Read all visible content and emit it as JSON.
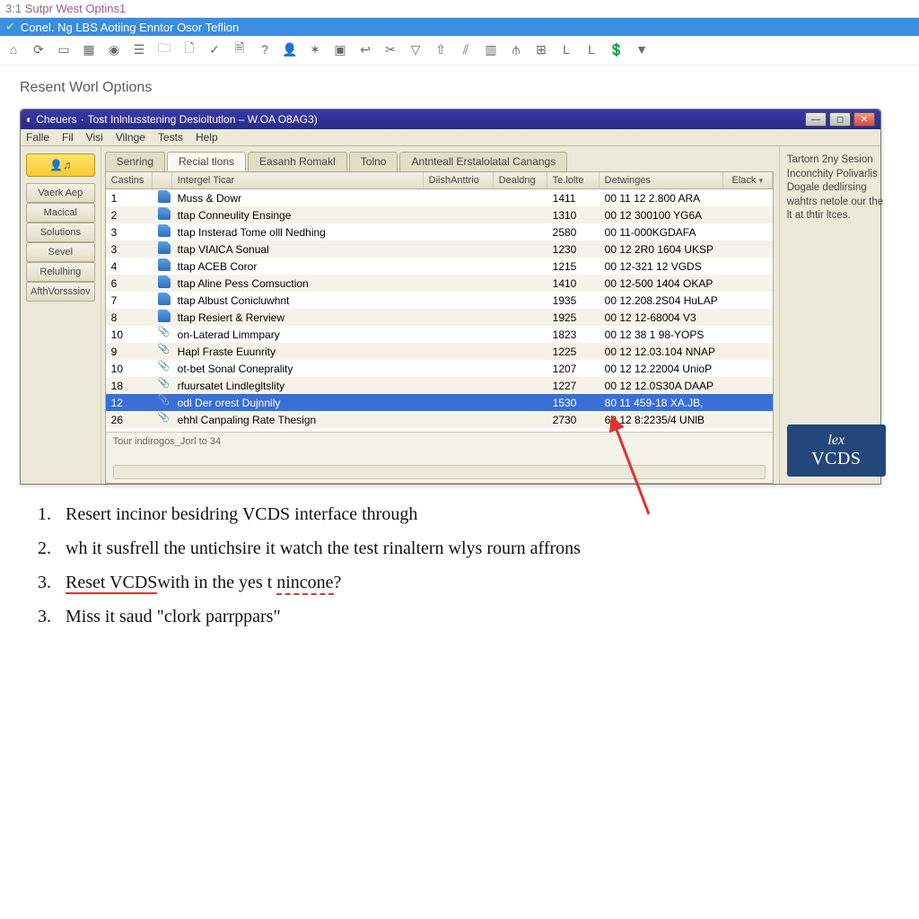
{
  "topbar1": {
    "prefix": "3:1",
    "title": "Sutpr West Optins1"
  },
  "topbar2": {
    "text": "Conel. Ng  LBS  Aotiing  Enntor  Osor  Teflion"
  },
  "toolbar_icons": [
    "home",
    "refresh",
    "window",
    "grid",
    "target",
    "form",
    "folder",
    "doc",
    "check",
    "page",
    "question",
    "user",
    "globe",
    "picture",
    "back",
    "scissors",
    "pin",
    "up",
    "chart",
    "grid2",
    "antenna",
    "table",
    "L1",
    "L2",
    "money",
    "filter"
  ],
  "page_title": "Resent Worl Options",
  "window": {
    "title": "Tost Inlnlusstening Desioltutlon – W.OA O8AG3)",
    "title_prefix": "Cheuers",
    "menus": [
      "Falle",
      "Fil",
      "Visi",
      "Vilnge",
      "Tests",
      "Help"
    ],
    "sidebar": {
      "buttons": [
        "Vaerk Aep",
        "Macical",
        "Solutions",
        "Sevel",
        "Relulhing",
        "AfthVorsssiov"
      ]
    },
    "tabs": [
      "Senring",
      "Recial tlons",
      "Easanh Romakl",
      "Tolno",
      "Antnteall Erstalolatal Canangs"
    ],
    "active_tab": 1,
    "columns": [
      "Castins",
      "Intergel Ticar",
      "DiishAnttrio",
      "Dealdng",
      "Te.lolte",
      "Detwinges",
      "Elack"
    ],
    "rows": [
      {
        "n": "1",
        "ic": "doc",
        "t": "Muss & Dowr",
        "d": "",
        "de": "",
        "te": "1411",
        "det": "00 11 12 2.800 ARA"
      },
      {
        "n": "2",
        "ic": "doc",
        "t": "ttap Conneulity Ensinge",
        "d": "",
        "de": "",
        "te": "1310",
        "det": "00 12 300100 YG6A"
      },
      {
        "n": "3",
        "ic": "doc",
        "t": "ttap Insterad Tome olll Nedhing",
        "d": "",
        "de": "",
        "te": "2580",
        "det": "00 11-000KGDAFA"
      },
      {
        "n": "3",
        "ic": "doc",
        "t": "ttap VIAlCA Sonual",
        "d": "",
        "de": "",
        "te": "1230",
        "det": "00 12 2R0 1604 UKSP"
      },
      {
        "n": "4",
        "ic": "doc",
        "t": "ttap ACEB Coror",
        "d": "",
        "de": "",
        "te": "1215",
        "det": "00 12-321 12 VGDS"
      },
      {
        "n": "6",
        "ic": "doc",
        "t": "ttap Aline Pess Comsuction",
        "d": "",
        "de": "",
        "te": "1410",
        "det": "00 12-500 1404 OKAP"
      },
      {
        "n": "7",
        "ic": "doc",
        "t": "ttap Albust Conicluwhnt",
        "d": "",
        "de": "",
        "te": "1935",
        "det": "00 12.208.2S04 HuLAP"
      },
      {
        "n": "8",
        "ic": "doc",
        "t": "ttap Resiert & Rerview",
        "d": "",
        "de": "",
        "te": "1925",
        "det": "00 12 12-68004 V3"
      },
      {
        "n": "10",
        "ic": "clip",
        "t": "on-Laterad Limmpary",
        "d": "",
        "de": "",
        "te": "1823",
        "det": "00 12 38 1 98-YOPS"
      },
      {
        "n": "9",
        "ic": "clip",
        "t": "Hapl Fraste Euunrity",
        "d": "",
        "de": "",
        "te": "1225",
        "det": "00 12 12.03.104 NNAP"
      },
      {
        "n": "10",
        "ic": "clip",
        "t": "ot-bet Sonal Coneprality",
        "d": "",
        "de": "",
        "te": "1207",
        "det": "00 12 12.22004 UnioP"
      },
      {
        "n": "18",
        "ic": "clip",
        "t": "rfuursatet Lindlegltslity",
        "d": "",
        "de": "",
        "te": "1227",
        "det": "00 12 12.0S30A DAAP"
      },
      {
        "n": "12",
        "ic": "clip",
        "t": "odl  Der orest Dujnnily",
        "d": "",
        "de": "",
        "te": "1530",
        "det": "80 11 459-18 XA.JB,",
        "sel": true
      },
      {
        "n": "26",
        "ic": "clip",
        "t": "ehhl Canpaling Rate Thesign",
        "d": "",
        "de": "",
        "te": "2730",
        "det": "60 12 8:2235/4 UNlB"
      }
    ],
    "footer": "Tour indirogos_Jorl to 34",
    "right_text": "Tartorn 2ny Sesion Inconchity Polivarlis Dogale dedlirsing wahtrs netole our the lt at thtir ltces.",
    "logo": {
      "l1": "lex",
      "l2": "VCDS"
    }
  },
  "instructions": [
    {
      "n": "1.",
      "text": "Resert incinor besidring VCDS interface through"
    },
    {
      "n": "2.",
      "text": "wh it susfrell the untichsire it watch the test rinaltern wlys rourn affrons"
    },
    {
      "n": "3.",
      "text_parts": [
        {
          "t": "Reset VCDS",
          "cls": "red-under"
        },
        {
          "t": "with in the yes t "
        },
        {
          "t": "nincone",
          "cls": "red-dash"
        },
        {
          "t": "?"
        }
      ]
    },
    {
      "n": "3.",
      "text": "Miss it saud \"clork parrppars\""
    }
  ]
}
